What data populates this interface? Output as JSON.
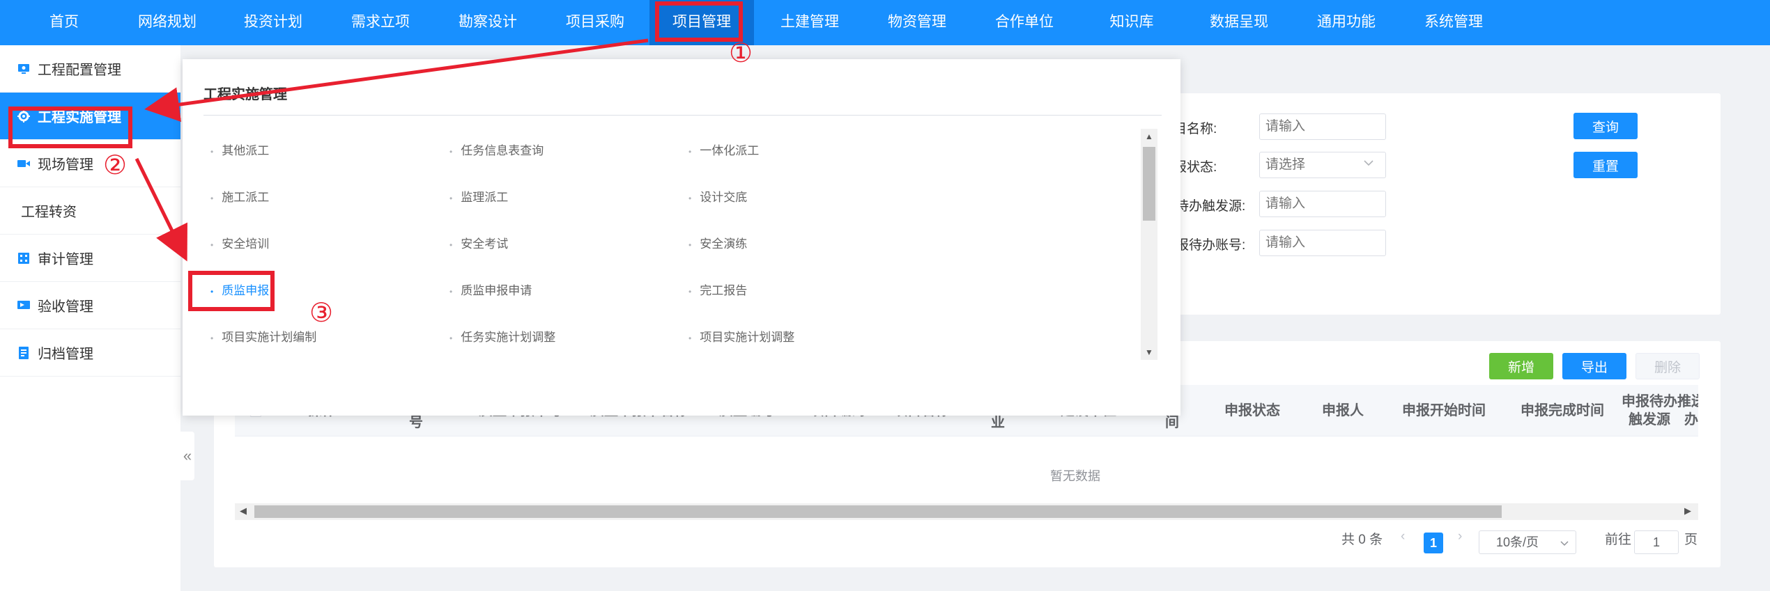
{
  "topnav": {
    "items": [
      "首页",
      "网络规划",
      "投资计划",
      "需求立项",
      "勘察设计",
      "项目采购",
      "项目管理",
      "土建管理",
      "物资管理",
      "合作单位",
      "知识库",
      "数据呈现",
      "通用功能",
      "系统管理"
    ],
    "active_index": 6
  },
  "sidebar": {
    "items": [
      {
        "label": "工程配置管理",
        "icon": "monitor-icon"
      },
      {
        "label": "工程实施管理",
        "icon": "gear-icon"
      },
      {
        "label": "现场管理",
        "icon": "camera-icon"
      },
      {
        "label": "工程转资",
        "icon": ""
      },
      {
        "label": "审计管理",
        "icon": "calculator-icon"
      },
      {
        "label": "验收管理",
        "icon": "flag-icon"
      },
      {
        "label": "归档管理",
        "icon": "document-icon"
      }
    ],
    "collapse_label": "«"
  },
  "search": {
    "fields": [
      {
        "label": "项目名称:",
        "placeholder": "请输入"
      },
      {
        "label": "申报状态:",
        "placeholder": "请选择"
      },
      {
        "label": "待办触发源:",
        "placeholder": "请输入"
      },
      {
        "label": "报待办账号:",
        "placeholder": "请输入"
      }
    ],
    "query_label": "查询",
    "reset_label": "重置"
  },
  "table": {
    "add_label": "新增",
    "export_label": "导出",
    "delete_label": "删除",
    "columns": [
      "操作",
      "号",
      "质监申报单号",
      "质监申报单名称",
      "质监编号",
      "项目编码",
      "项目名称",
      "业",
      "建设单位",
      "间",
      "申报状态",
      "申报人",
      "申报开始时间",
      "申报完成时间",
      "申报待办触发源",
      "推送办"
    ],
    "empty_text": "暂无数据"
  },
  "pagination": {
    "total_text": "共 0 条",
    "current_page": "1",
    "page_size": "10条/页",
    "goto_prefix": "前往",
    "goto_value": "1",
    "goto_suffix": "页"
  },
  "dropdown": {
    "title": "工程实施管理",
    "items": [
      [
        "其他派工",
        "任务信息表查询",
        "一体化派工"
      ],
      [
        "施工派工",
        "监理派工",
        "设计交底"
      ],
      [
        "安全培训",
        "安全考试",
        "安全演练"
      ],
      [
        "质监申报",
        "质监申报申请",
        "完工报告"
      ],
      [
        "项目实施计划编制",
        "任务实施计划调整",
        "项目实施计划调整"
      ]
    ]
  },
  "annotations": [
    "①",
    "②",
    "③"
  ],
  "colors": {
    "primary": "#1890ff",
    "annotation": "#e8202f",
    "success": "#67c23a"
  }
}
